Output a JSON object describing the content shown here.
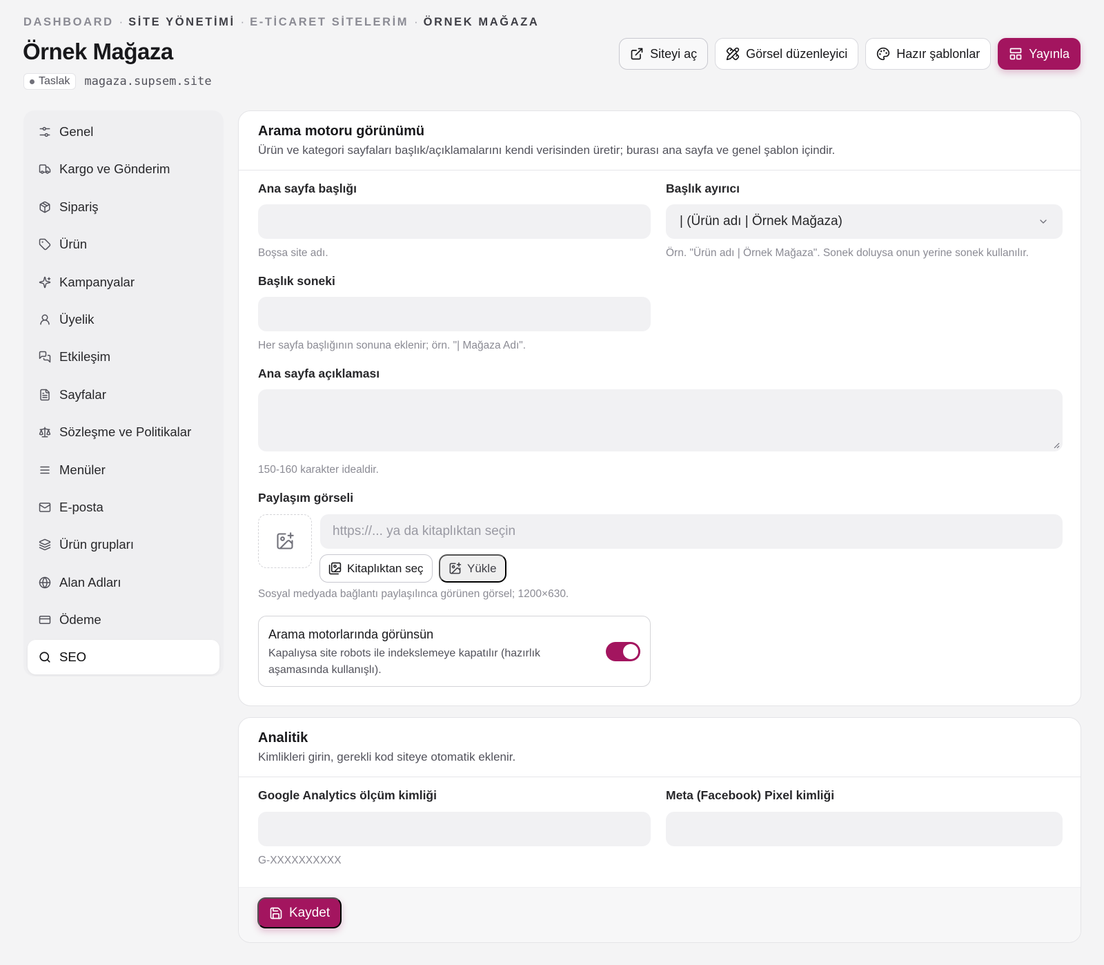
{
  "breadcrumb": {
    "items": [
      "DASHBOARD",
      "SİTE YÖNETİMİ",
      "E-TİCARET SİTELERİM",
      "ÖRNEK MAĞAZA"
    ],
    "separator": "·"
  },
  "header": {
    "title": "Örnek Mağaza",
    "status_badge": "Taslak",
    "domain": "magaza.supsem.site"
  },
  "actions": {
    "open_site": "Siteyi aç",
    "visual_editor": "Görsel düzenleyici",
    "templates": "Hazır şablonlar",
    "publish": "Yayınla"
  },
  "sidebar": {
    "items": [
      {
        "label": "Genel",
        "icon": "sliders-icon"
      },
      {
        "label": "Kargo ve Gönderim",
        "icon": "truck-icon"
      },
      {
        "label": "Sipariş",
        "icon": "package-icon"
      },
      {
        "label": "Ürün",
        "icon": "tag-icon"
      },
      {
        "label": "Kampanyalar",
        "icon": "sparkles-icon"
      },
      {
        "label": "Üyelik",
        "icon": "user-icon"
      },
      {
        "label": "Etkileşim",
        "icon": "messages-icon"
      },
      {
        "label": "Sayfalar",
        "icon": "file-icon"
      },
      {
        "label": "Sözleşme ve Politikalar",
        "icon": "scale-icon"
      },
      {
        "label": "Menüler",
        "icon": "menu-icon"
      },
      {
        "label": "E-posta",
        "icon": "mail-icon"
      },
      {
        "label": "Ürün grupları",
        "icon": "layers-icon"
      },
      {
        "label": "Alan Adları",
        "icon": "globe-icon"
      },
      {
        "label": "Ödeme",
        "icon": "credit-card-icon"
      },
      {
        "label": "SEO",
        "icon": "search-icon"
      }
    ],
    "active": "SEO"
  },
  "seo_card": {
    "title": "Arama motoru görünümü",
    "description": "Ürün ve kategori sayfaları başlık/açıklamalarını kendi verisinden üretir; burası ana sayfa ve genel şablon içindir.",
    "home_title_label": "Ana sayfa başlığı",
    "home_title_value": "",
    "home_title_hint": "Boşsa site adı.",
    "separator_label": "Başlık ayırıcı",
    "separator_value": "| (Ürün adı | Örnek Mağaza)",
    "separator_hint": "Örn. \"Ürün adı | Örnek Mağaza\". Sonek doluysa onun yerine sonek kullanılır.",
    "suffix_label": "Başlık soneki",
    "suffix_value": "",
    "suffix_hint": "Her sayfa başlığının sonuna eklenir; örn. \"| Mağaza Adı\".",
    "description_label": "Ana sayfa açıklaması",
    "description_value": "",
    "description_hint": "150-160 karakter idealdir.",
    "share_image_label": "Paylaşım görseli",
    "share_image_placeholder": "https://... ya da kitaplıktan seçin",
    "library_button": "Kitaplıktan seç",
    "upload_button": "Yükle",
    "share_image_hint": "Sosyal medyada bağlantı paylaşılınca görünen görsel; 1200×630.",
    "index_toggle_title": "Arama motorlarında görünsün",
    "index_toggle_desc": "Kapalıysa site robots ile indekslemeye kapatılır (hazırlık aşamasında kullanışlı).",
    "index_toggle_on": true
  },
  "analytics_card": {
    "title": "Analitik",
    "description": "Kimlikleri girin, gerekli kod siteye otomatik eklenir.",
    "ga_label": "Google Analytics ölçüm kimliği",
    "ga_value": "",
    "ga_hint": "G-XXXXXXXXXX",
    "pixel_label": "Meta (Facebook) Pixel kimliği",
    "pixel_value": "",
    "save_button": "Kaydet"
  },
  "colors": {
    "accent": "#a3155f",
    "background": "#f4f4f5",
    "input": "#f1f1f3"
  }
}
